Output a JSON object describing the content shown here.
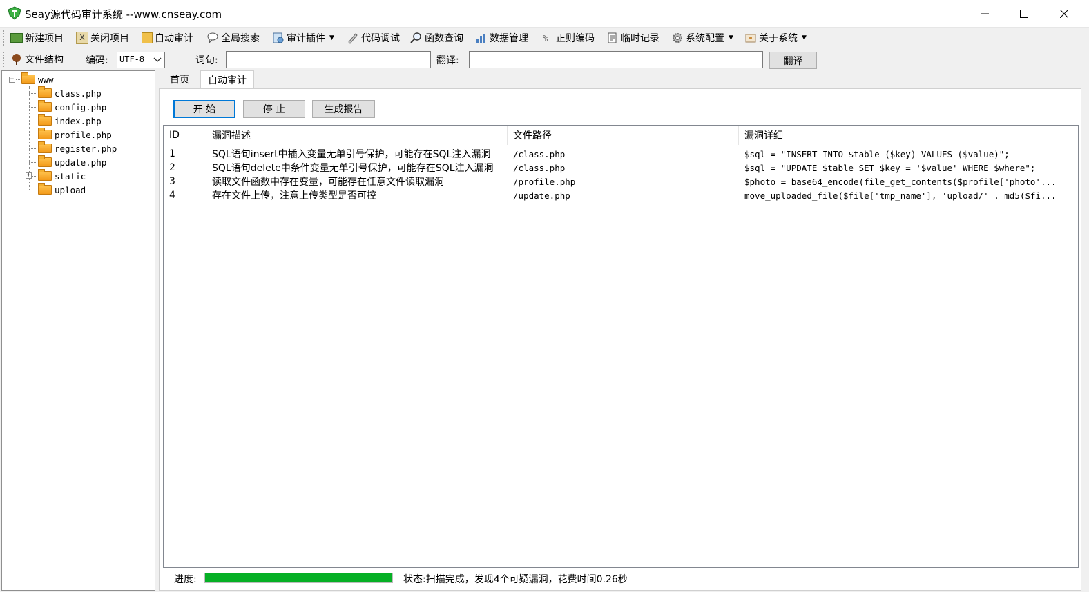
{
  "window": {
    "title": "Seay源代码审计系统 --www.cnseay.com"
  },
  "toolbar": {
    "items": [
      {
        "label": "新建项目",
        "icon": "new-project-icon"
      },
      {
        "label": "关闭项目",
        "icon": "close-project-icon"
      },
      {
        "label": "自动审计",
        "icon": "auto-audit-icon"
      },
      {
        "label": "全局搜索",
        "icon": "global-search-icon"
      },
      {
        "label": "审计插件",
        "icon": "plugin-icon",
        "dropdown": true
      },
      {
        "label": "代码调试",
        "icon": "debug-icon"
      },
      {
        "label": "函数查询",
        "icon": "function-search-icon"
      },
      {
        "label": "数据管理",
        "icon": "data-manage-icon"
      },
      {
        "label": "正则编码",
        "icon": "regex-icon"
      },
      {
        "label": "临时记录",
        "icon": "notes-icon"
      },
      {
        "label": "系统配置",
        "icon": "gear-icon",
        "dropdown": true
      },
      {
        "label": "关于系统",
        "icon": "about-icon",
        "dropdown": true
      }
    ]
  },
  "bar2": {
    "file_structure_label": "文件结构",
    "encoding_label": "编码:",
    "encoding_value": "UTF-8",
    "word_label": "词句:",
    "word_value": "",
    "translate_label": "翻译:",
    "translate_value": "",
    "translate_button": "翻译"
  },
  "tree": {
    "root": "www",
    "items": [
      "class.php",
      "config.php",
      "index.php",
      "profile.php",
      "register.php",
      "update.php",
      "static",
      "upload"
    ]
  },
  "tabs": [
    {
      "label": "首页",
      "active": false
    },
    {
      "label": "自动审计",
      "active": true
    }
  ],
  "audit": {
    "start_button": "开 始",
    "stop_button": "停 止",
    "report_button": "生成报告",
    "columns": [
      "ID",
      "漏洞描述",
      "文件路径",
      "漏洞详细"
    ],
    "rows": [
      {
        "id": "1",
        "desc": "SQL语句insert中插入变量无单引号保护，可能存在SQL注入漏洞",
        "path": "/class.php",
        "detail": "$sql = \"INSERT INTO $table ($key) VALUES ($value)\";"
      },
      {
        "id": "2",
        "desc": "SQL语句delete中条件变量无单引号保护，可能存在SQL注入漏洞",
        "path": "/class.php",
        "detail": "$sql = \"UPDATE $table SET $key = '$value' WHERE $where\";"
      },
      {
        "id": "3",
        "desc": "读取文件函数中存在变量，可能存在任意文件读取漏洞",
        "path": "/profile.php",
        "detail": "$photo = base64_encode(file_get_contents($profile['photo'..."
      },
      {
        "id": "4",
        "desc": "存在文件上传，注意上传类型是否可控",
        "path": "/update.php",
        "detail": "move_uploaded_file($file['tmp_name'], 'upload/' . md5($fi..."
      }
    ]
  },
  "status": {
    "progress_label": "进度:",
    "progress_value": 1.0,
    "status_text": "状态:扫描完成，发现4个可疑漏洞，花费时间0.26秒",
    "progress_color": "#06b025"
  }
}
